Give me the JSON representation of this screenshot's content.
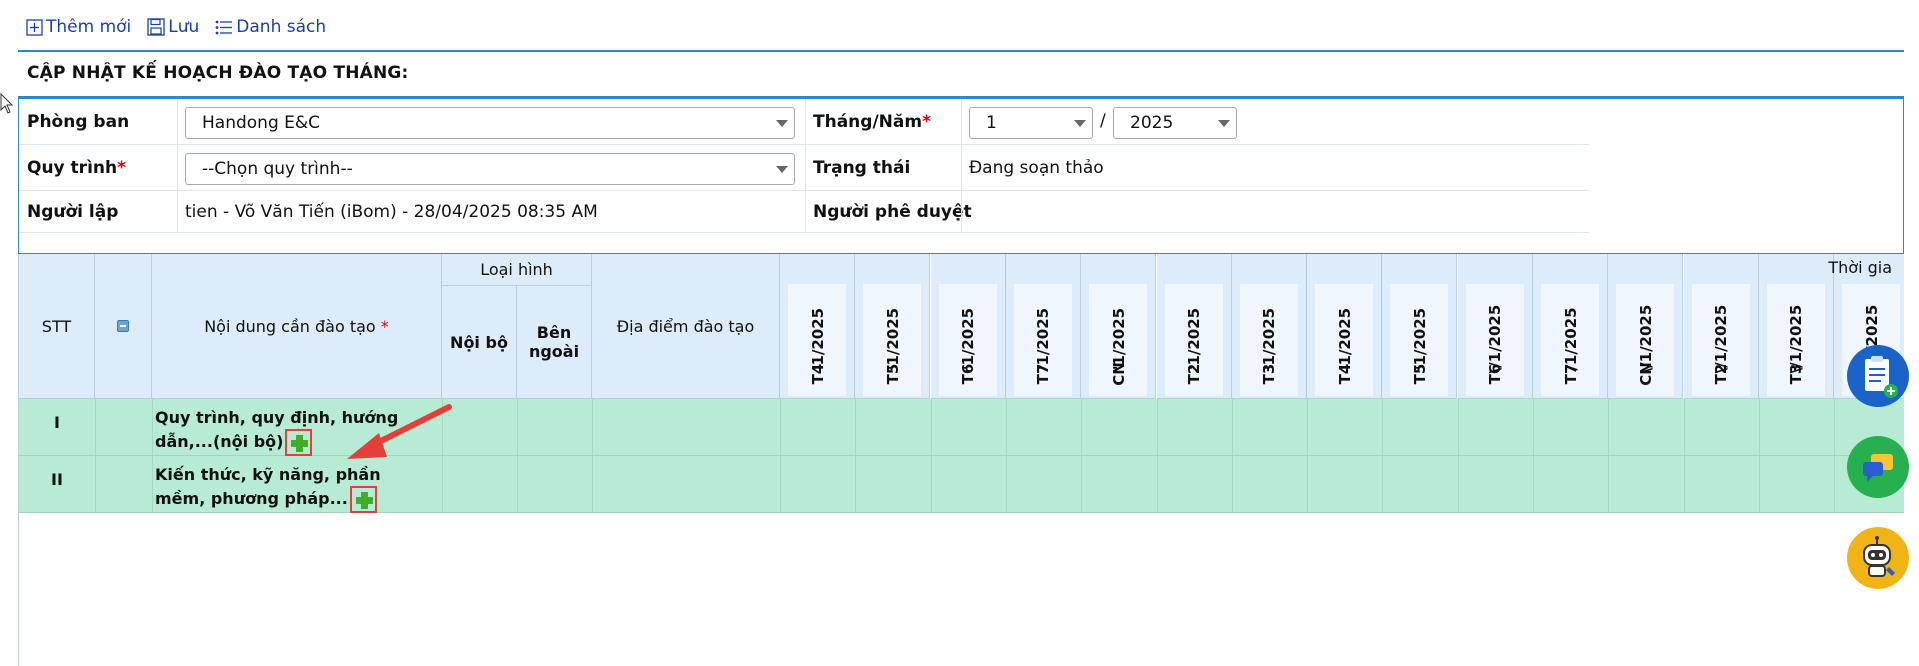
{
  "toolbar": {
    "add_label": "Thêm mới",
    "save_label": "Lưu",
    "list_label": "Danh sách"
  },
  "page_title": "CẬP NHẬT KẾ HOẠCH ĐÀO TẠO THÁNG:",
  "form": {
    "department_label": "Phòng ban",
    "department_value": "Handong E&C",
    "month_year_label": "Tháng/Năm",
    "month_value": "1",
    "year_value": "2025",
    "process_label": "Quy trình",
    "process_value": "--Chọn quy trình--",
    "status_label": "Trạng thái",
    "status_value": "Đang soạn thảo",
    "creator_label": "Người lập",
    "creator_value": "tien - Võ Văn Tiến (iBom) - 28/04/2025 08:35 AM",
    "approver_label": "Người phê duyệt",
    "approver_value": "",
    "required_mark": "*"
  },
  "grid": {
    "stt_header": "STT",
    "content_header": "Nội dung cần đào tạo",
    "type_header": "Loại hình",
    "internal_header": "Nội bộ",
    "external_header": "Bên ngoài",
    "location_header": "Địa điểm đào tạo",
    "time_header": "Thời gia",
    "days": [
      {
        "date": "'1/2025",
        "weekday": "T4"
      },
      {
        "date": "'1/2025",
        "weekday": "T5"
      },
      {
        "date": "'1/2025",
        "weekday": "T6"
      },
      {
        "date": "'1/2025",
        "weekday": "T7"
      },
      {
        "date": "'1/2025",
        "weekday": "CN"
      },
      {
        "date": "'1/2025",
        "weekday": "T2"
      },
      {
        "date": "'1/2025",
        "weekday": "T3"
      },
      {
        "date": "'1/2025",
        "weekday": "T4"
      },
      {
        "date": "'1/2025",
        "weekday": "T5"
      },
      {
        "date": "\\/1/2025",
        "weekday": "T6"
      },
      {
        "date": "/1/2025",
        "weekday": "T7"
      },
      {
        "date": "\\/1/2025",
        "weekday": "CN"
      },
      {
        "date": "\\/1/2025",
        "weekday": "T2"
      },
      {
        "date": "\\/1/2025",
        "weekday": "T3"
      },
      {
        "date": "\\/1/2025",
        "weekday": ""
      }
    ],
    "rows": [
      {
        "stt": "I",
        "content": "Quy trình, quy định, hướng dẫn,...(nội bộ)"
      },
      {
        "stt": "II",
        "content": "Kiến thức, kỹ năng, phần mềm, phương pháp..."
      }
    ]
  },
  "colors": {
    "accent": "#2f87c6",
    "header_bg": "#dcecfb",
    "row_bg": "#b8ebd3",
    "link": "#1a3ea8",
    "required": "#d00000"
  }
}
